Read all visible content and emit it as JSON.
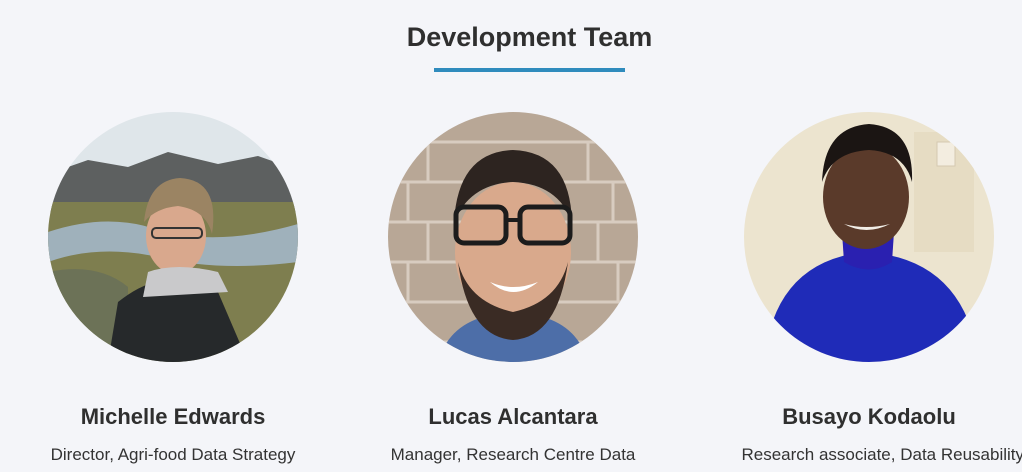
{
  "section": {
    "title": "Development Team"
  },
  "members": [
    {
      "name": "Michelle Edwards",
      "role": "Director, Agri-food Data Strategy",
      "photo_alt": "Michelle Edwards"
    },
    {
      "name": "Lucas Alcantara",
      "role": "Manager, Research Centre Data",
      "photo_alt": "Lucas Alcantara"
    },
    {
      "name": "Busayo Kodaolu",
      "role": "Research associate, Data Reusability",
      "photo_alt": "Busayo Kodaolu"
    }
  ],
  "colors": {
    "accent": "#2f8bbd",
    "background": "#f4f5f9"
  }
}
